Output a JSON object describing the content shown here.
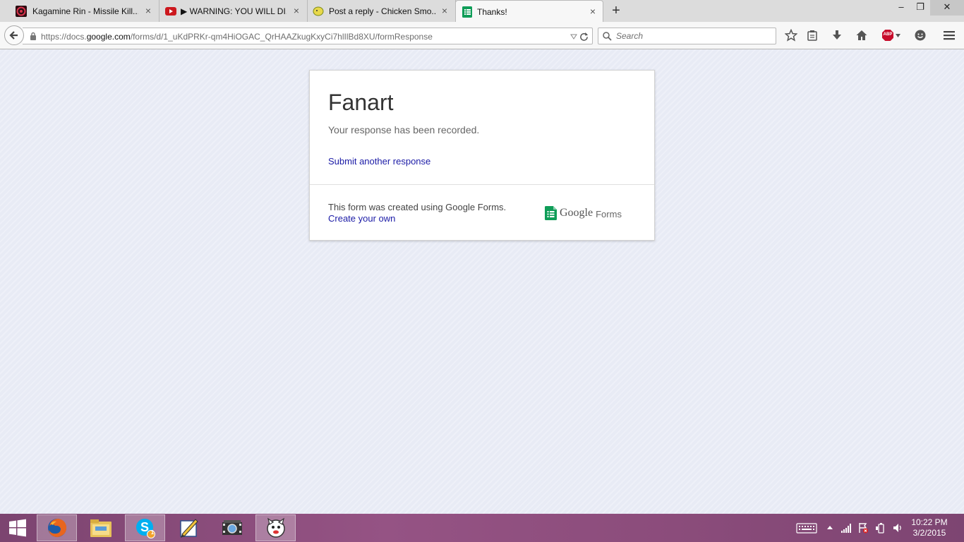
{
  "browser": {
    "tabs": [
      {
        "title": "Kagamine Rin - Missile Kill...",
        "favicon": "circle-record-icon"
      },
      {
        "title": "▶ WARNING: YOU WILL DI...",
        "favicon": "youtube-icon"
      },
      {
        "title": "Post a reply - Chicken Smo...",
        "favicon": "chicken-smoothie-icon"
      },
      {
        "title": "Thanks!",
        "favicon": "google-forms-icon",
        "active": true
      }
    ],
    "new_tab_symbol": "+",
    "window_controls": {
      "minimize": "–",
      "restore": "❐",
      "close": "✕"
    },
    "url": {
      "prefix": "https://docs.",
      "domain": "google.com",
      "path": "/forms/d/1_uKdPRKr-qm4HiOGAC_QrHAAZkugKxyCi7hlIlBd8XU/formResponse"
    },
    "search_placeholder": "Search",
    "toolbar_icons": [
      "bookmark-star-icon",
      "reading-list-icon",
      "download-icon",
      "home-icon",
      "adblock-plus-icon",
      "hello-chat-icon",
      "menu-icon"
    ],
    "adblock_label": "ABP"
  },
  "form": {
    "title": "Fanart",
    "confirmation": "Your response has been recorded.",
    "submit_another": "Submit another response",
    "footer_text": "This form was created using Google Forms.",
    "create_own": "Create your own",
    "logo_google": "Google",
    "logo_forms": "Forms",
    "brand_color": "#0f9d58",
    "link_color": "#1a1aa6"
  },
  "taskbar": {
    "apps": [
      "windows-start-icon",
      "firefox-icon",
      "file-explorer-icon",
      "skype-icon",
      "paint-tool-icon",
      "movie-maker-icon",
      "game-app-icon"
    ],
    "skype_badge": "1",
    "clock_time": "10:22 PM",
    "clock_date": "3/2/2015",
    "accent_color": "#8a4a78"
  }
}
